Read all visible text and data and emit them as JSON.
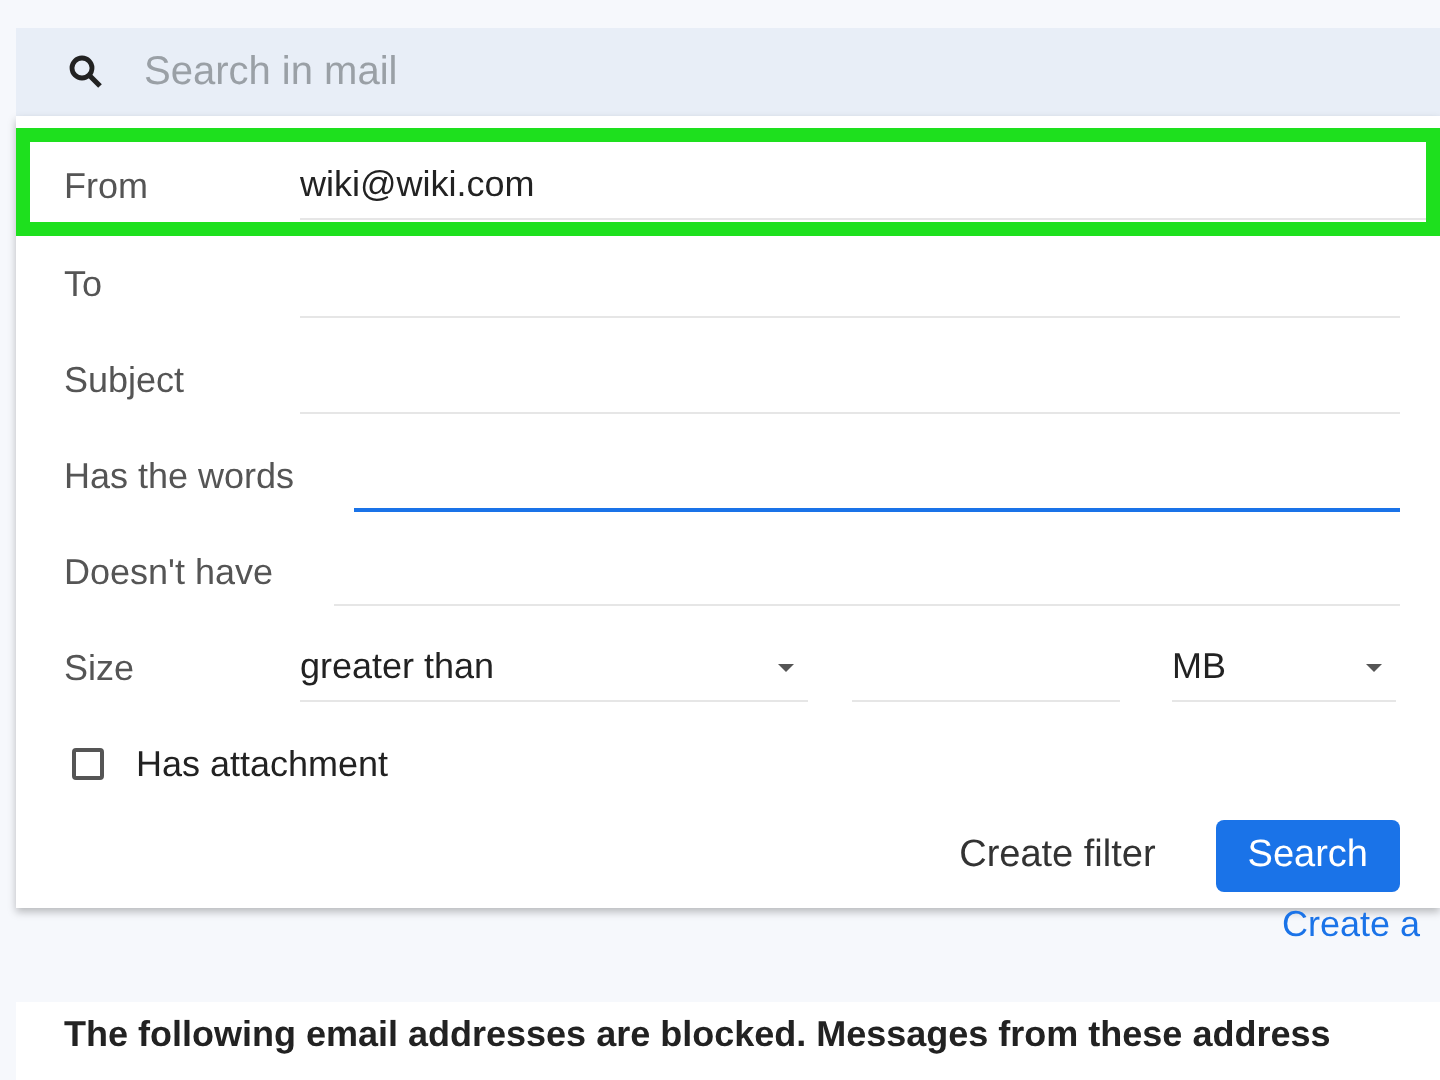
{
  "search": {
    "placeholder": "Search in mail"
  },
  "fields": [
    {
      "label": "From",
      "value": "wiki@wiki.com",
      "focused": false,
      "highlighted": true
    },
    {
      "label": "To",
      "focused": false,
      "highlighted": false
    },
    {
      "label": "Subject",
      "focused": false,
      "highlighted": false
    },
    {
      "label": "Has the words",
      "focused": true,
      "highlighted": false
    },
    {
      "label": "Doesn't have",
      "focused": false,
      "highlighted": false
    }
  ],
  "size": {
    "label": "Size",
    "comparison": "greater than",
    "unit": "MB"
  },
  "attachment": {
    "label": "Has attachment",
    "checked": false
  },
  "buttons": {
    "create_filter": "Create filter",
    "search": "Search"
  },
  "link": "Create a",
  "blocked_text": "The following email addresses are blocked. Messages from these address"
}
